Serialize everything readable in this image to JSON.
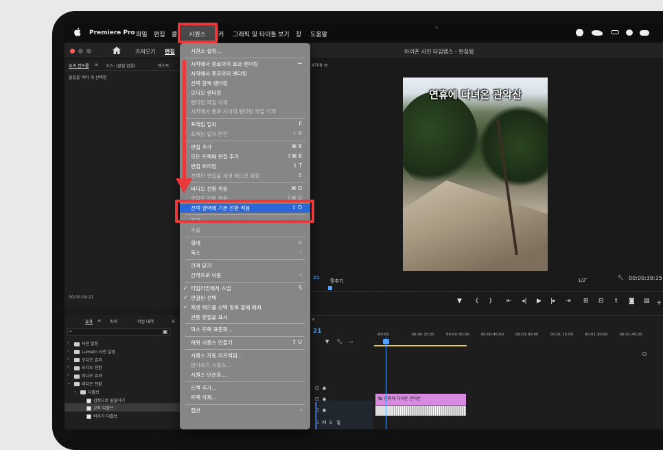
{
  "menubar": {
    "app_name": "Premiere Pro",
    "items": [
      "파일",
      "편집",
      "클",
      "시퀀스",
      "커",
      "그래픽 및 타이틀",
      "보기",
      "창",
      "도움말"
    ]
  },
  "header": {
    "home_tabs": [
      "가져오기",
      "편집"
    ],
    "window_title": "아이폰 사진 타임랩스 - 편집됨"
  },
  "left_panel": {
    "tabs": [
      "효과 컨트롤",
      "소스: (클립 없음)",
      "텍스트"
    ],
    "message": "클립을 여러 개 선택함",
    "timecode": "00:00:04:21"
  },
  "effects_panel": {
    "tabs": [
      "효과",
      "마커",
      "작업 내역",
      "프"
    ],
    "tree": [
      {
        "label": "사전 설정",
        "type": "folder",
        "level": 0,
        "open": false
      },
      {
        "label": "Lumetri 사전 설정",
        "type": "folder",
        "level": 0,
        "open": false
      },
      {
        "label": "오디오 효과",
        "type": "folder",
        "level": 0,
        "open": false
      },
      {
        "label": "오디오 전환",
        "type": "folder",
        "level": 0,
        "open": false
      },
      {
        "label": "비디오 효과",
        "type": "folder",
        "level": 0,
        "open": false
      },
      {
        "label": "비디오 전환",
        "type": "folder",
        "level": 0,
        "open": true
      },
      {
        "label": "디졸브",
        "type": "folder",
        "level": 1,
        "open": true
      },
      {
        "label": "검정으로 물들이기",
        "type": "effect",
        "level": 2
      },
      {
        "label": "교차 디졸브",
        "type": "effect",
        "level": 2,
        "selected": true
      },
      {
        "label": "비추가 디졸브",
        "type": "effect",
        "level": 2
      }
    ]
  },
  "monitor": {
    "sequence_tc": "4708",
    "caption": "연휴에 다녀온 관악산",
    "left_tc_suffix": "21",
    "fit_label": "맞추기",
    "ratio": "1/2",
    "end_timecode": "00:00:39:15"
  },
  "timeline": {
    "tc_suffix": "21",
    "ruler": [
      ":00:00",
      "00:00:15:00",
      "00:00:30:00",
      "00:00:45:00",
      "00:01:00:00",
      "00:01:15:00",
      "00:01:30:00",
      "00:01:45:00"
    ],
    "clip_label": "연휴에 다녀온 관악산",
    "track_ms": [
      "M",
      "S"
    ]
  },
  "menu": {
    "items": [
      {
        "label": "시퀀스 설정...",
        "shortcut": "",
        "disabled": false
      },
      {
        "sep": true
      },
      {
        "label": "시작에서 종료까지 효과 렌더링",
        "shortcut": "↩",
        "disabled": false
      },
      {
        "label": "시작에서 종료까지 렌더링",
        "shortcut": "",
        "disabled": false
      },
      {
        "label": "선택 항목 렌더링",
        "shortcut": "",
        "disabled": false
      },
      {
        "label": "오디오 렌더링",
        "shortcut": "",
        "disabled": false
      },
      {
        "label": "렌더링 파일 삭제",
        "shortcut": "",
        "disabled": true
      },
      {
        "label": "시작에서 종료 사이의 렌더링 파일 삭제",
        "shortcut": "",
        "disabled": true
      },
      {
        "sep": true
      },
      {
        "label": "프레임 일치",
        "shortcut": "F",
        "disabled": false
      },
      {
        "label": "프레임 일치 반전",
        "shortcut": "⇧ R",
        "disabled": true
      },
      {
        "sep": true
      },
      {
        "label": "편집 추가",
        "shortcut": "⌘ K",
        "disabled": false
      },
      {
        "label": "모든 트랙에 편집 추가",
        "shortcut": "⇧⌘ K",
        "disabled": false
      },
      {
        "label": "편집 트리밍",
        "shortcut": "⇧ T",
        "disabled": false
      },
      {
        "label": "선택한 편집을 재생 헤드로 확장",
        "shortcut": "E",
        "disabled": true
      },
      {
        "sep": true
      },
      {
        "label": "비디오 전환 적용",
        "shortcut": "⌘ D",
        "disabled": false
      },
      {
        "label": "오디오 전환 적용",
        "shortcut": "⇧⌘ D",
        "disabled": true
      },
      {
        "label": "선택 영역에 기본 전환 적용",
        "shortcut": "⇧ D",
        "disabled": false,
        "highlighted": true
      },
      {
        "sep": true
      },
      {
        "label": "제거",
        "shortcut": ";",
        "disabled": true
      },
      {
        "label": "추출",
        "shortcut": "'",
        "disabled": true
      },
      {
        "sep": true
      },
      {
        "label": "확대",
        "shortcut": "=",
        "disabled": false
      },
      {
        "label": "축소",
        "shortcut": "-",
        "disabled": false
      },
      {
        "sep": true
      },
      {
        "label": "간격 닫기",
        "shortcut": "",
        "disabled": false
      },
      {
        "label": "간격으로 이동",
        "shortcut": "›",
        "disabled": false
      },
      {
        "sep": true
      },
      {
        "label": "타임라인에서 스냅",
        "shortcut": "S",
        "disabled": false,
        "checked": true
      },
      {
        "label": "연결된 선택",
        "shortcut": "",
        "disabled": false,
        "checked": true
      },
      {
        "label": "재생 헤드를 선택 항목 앞에 배치",
        "shortcut": "",
        "disabled": false,
        "checked": true
      },
      {
        "label": "관통 편집을 표시",
        "shortcut": "",
        "disabled": false
      },
      {
        "sep": true
      },
      {
        "label": "믹스 트랙 표준화...",
        "shortcut": "",
        "disabled": false
      },
      {
        "sep": true
      },
      {
        "label": "하위 시퀀스 만들기",
        "shortcut": "⇧ U",
        "disabled": false
      },
      {
        "sep": true
      },
      {
        "label": "시퀀스 자동 리프레임...",
        "shortcut": "",
        "disabled": false
      },
      {
        "label": "받아쓰기 시퀀스...",
        "shortcut": "",
        "disabled": true
      },
      {
        "label": "시퀀스 단순화...",
        "shortcut": "",
        "disabled": false
      },
      {
        "sep": true
      },
      {
        "label": "트랙 추가...",
        "shortcut": "",
        "disabled": false
      },
      {
        "label": "트랙 삭제...",
        "shortcut": "",
        "disabled": false
      },
      {
        "sep": true
      },
      {
        "label": "캡션",
        "shortcut": "›",
        "disabled": false
      }
    ]
  },
  "colors": {
    "annotation_red": "#e8393d",
    "highlight_blue": "#2b67d8",
    "clip_pink": "#d889e0"
  }
}
